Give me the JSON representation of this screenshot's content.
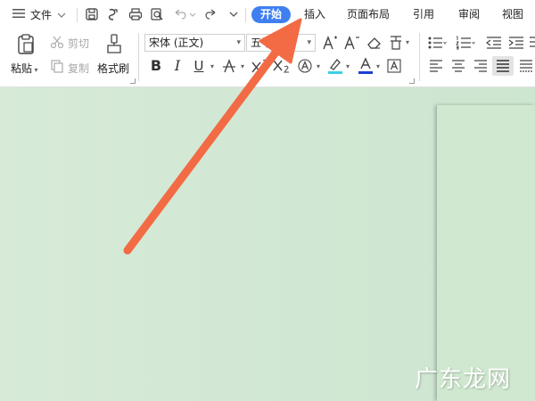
{
  "menubar": {
    "file_label": "文件",
    "tabs": [
      {
        "label": "开始",
        "active": true
      },
      {
        "label": "插入",
        "active": false
      },
      {
        "label": "页面布局",
        "active": false
      },
      {
        "label": "引用",
        "active": false
      },
      {
        "label": "审阅",
        "active": false
      },
      {
        "label": "视图",
        "active": false
      }
    ]
  },
  "ribbon": {
    "paste_label": "粘贴",
    "cut_label": "剪切",
    "copy_label": "复制",
    "format_painter_label": "格式刷",
    "font_name": "宋体 (正文)",
    "font_size": "五号",
    "bold": "B",
    "italic": "I",
    "underline": "U",
    "font_color_accent": "#1f3fd1",
    "highlight_accent": "#39d0e6"
  },
  "watermark": "广东龙网",
  "colors": {
    "active_tab": "#3f7ff0",
    "arrow": "#f26b45",
    "background": "#d3e8d6"
  }
}
